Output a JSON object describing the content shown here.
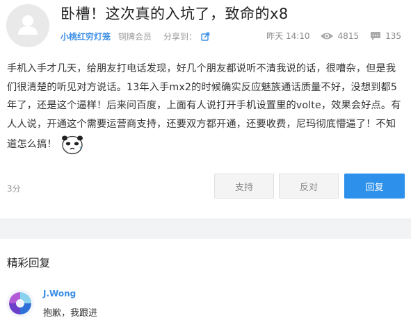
{
  "post": {
    "title": "卧槽！这次真的入坑了，致命的x8",
    "author": "小桃红穷灯笼",
    "level": "铜牌会员",
    "share_label": "分享到：",
    "time": "昨天 14:10",
    "views": "4815",
    "comments": "135",
    "body": "手机入手才几天，给朋友打电话发现，好几个朋友都说听不清我说的话，很嘈杂，但是我们很清楚的听见对方说话。13年入手mx2的时候确实反应魅族通话质量不好，没想到都5年了，还是这个逼样！后来问百度，上面有人说打开手机设置里的volte，效果会好点。有人人说，开通这个需要运营商支持，还要双方都开通，还要收费，尼玛彻底懵逼了！不知道怎么搞！",
    "score": "3分"
  },
  "actions": {
    "support": "支持",
    "oppose": "反对",
    "reply": "回复"
  },
  "replies": {
    "section_title": "精彩回复",
    "items": [
      {
        "name": "J.Wong",
        "text": "抱歉，我跟进"
      }
    ]
  },
  "colors": {
    "accent": "#2d90ea",
    "link": "#3a8ee6",
    "band": "#f2f3f5"
  },
  "icons": [
    "default-avatar-icon",
    "share-icon",
    "eye-icon",
    "comment-icon",
    "panda-emoji-icon"
  ]
}
